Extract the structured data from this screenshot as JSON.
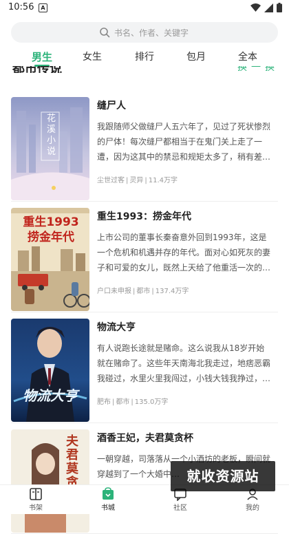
{
  "status_bar": {
    "time": "10:56",
    "notification_letter": "A"
  },
  "search": {
    "placeholder": "书名、作者、关键字"
  },
  "tabs": [
    {
      "label": "男生",
      "active": true
    },
    {
      "label": "女生",
      "active": false
    },
    {
      "label": "排行",
      "active": false
    },
    {
      "label": "包月",
      "active": false
    },
    {
      "label": "全本",
      "active": false
    }
  ],
  "section_peek": {
    "title": "都市传说",
    "more": "换一换"
  },
  "books": [
    {
      "title": "缝尸人",
      "description": "我跟随师父做缝尸人五六年了，见过了死状惨烈的尸体！每次缝尸都相当于在鬼门关上走了一遭，因为这其中的禁忌和规矩太多了，稍有差…",
      "author": "尘世过客",
      "category": "灵异",
      "words": "11.4万字",
      "cover_text": "花溪小说"
    },
    {
      "title": "重生1993：捞金年代",
      "description": "上市公司的董事长秦奋意外回到1993年，这是一个危机和机遇并存的年代。面对心如死灰的妻子和可爱的女儿，既然上天给了他重活一次的…",
      "author": "户口未申报",
      "category": "都市",
      "words": "137.4万字",
      "cover_text": "重生1993 捞金年代"
    },
    {
      "title": "物流大亨",
      "description": "有人说跑长途就是赌命。这么说我从18岁开始就在赌命了。这些年天南海北我走过，地痞恶霸我碰过，水里火里我闯过，小钱大钱我挣过，…",
      "author": "肥布",
      "category": "都市",
      "words": "135.0万字",
      "cover_text": "物流大亨"
    },
    {
      "title": "酒香王妃，夫君莫贪杯",
      "description": "一朝穿越，司落落从一个小酒坊的老板，瞬间就穿越到了一个大婚中…",
      "author": "",
      "category": "",
      "words": "",
      "cover_text": "夫君莫贪杯"
    }
  ],
  "watermark": "就收资源站",
  "bottom_nav": [
    {
      "label": "书架",
      "icon": "bookshelf-icon",
      "active": false
    },
    {
      "label": "书城",
      "icon": "bookstore-icon",
      "active": true
    },
    {
      "label": "社区",
      "icon": "community-icon",
      "active": false
    },
    {
      "label": "我的",
      "icon": "profile-icon",
      "active": false
    }
  ],
  "colors": {
    "accent": "#2cb37a",
    "text": "#222222",
    "muted": "#9a9a9a"
  }
}
